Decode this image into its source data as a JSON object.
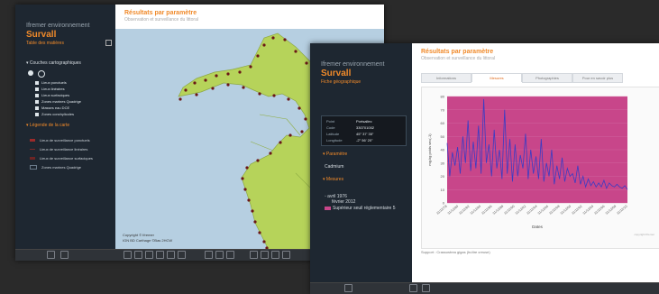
{
  "windows": [
    {
      "app": {
        "logo_text": "Ifremer environnement",
        "brand": "Survall"
      },
      "sidebar": {
        "toc_title": "Table des matières",
        "layers_title": "Couches cartographiques",
        "layers": [
          "Lieux ponctuels",
          "Lieux linéaires",
          "Lieux surfaciques",
          "Zones marines Quadrige",
          "Masses eau DCE",
          "Zones conchylicoles"
        ],
        "legend_title": "Légende de la carte",
        "legend": [
          "Lieux de surveillance ponctuels",
          "Lieux de surveillance linéaires",
          "Lieux de surveillance surfaciques",
          "Zones marines Quadrige"
        ]
      },
      "main": {
        "title": "Résultats par paramètre",
        "subtitle": "Observation et surveillance du littoral",
        "copyright": "Copyright © Ifremer",
        "map_credit": "IGN BD Carthage ©Bas 2HCW"
      }
    },
    {
      "app": {
        "logo_text": "Ifremer environnement",
        "brand": "Survall"
      },
      "sidebar": {
        "fiche_title": "Fiche géographique",
        "info": [
          {
            "label": "Point",
            "value": "Portsallec"
          },
          {
            "label": "Code",
            "value": "330701002"
          },
          {
            "label": "Latitude",
            "value": "45° 37' 35\""
          },
          {
            "label": "Longitude",
            "value": "-2° 56' 20\""
          }
        ],
        "param_title": "Paramètre",
        "param_value": "Cadmium",
        "mesures_title": "Mesures",
        "mesure_from": "avril 1976",
        "mesure_to": "février 2012",
        "mesure_flag": "Supérieur seuil réglementaire",
        "mesure_flag_count": "5"
      },
      "main": {
        "title": "Résultats par paramètre",
        "subtitle": "Observation et surveillance du littoral",
        "tabs": [
          "Informations",
          "Mesures",
          "Photographies",
          "Pour en savoir plus"
        ],
        "active_tab": "Mesures",
        "support": "Support : Crassostrea gigas (huître creuse)",
        "copyright": "copyright Ifremer"
      }
    }
  ],
  "chart_data": {
    "type": "line",
    "title": "",
    "xlabel": "Dates",
    "ylabel": "mg.kg poids sec(-1)",
    "ylim": [
      0,
      80
    ],
    "yticks": [
      0,
      10,
      20,
      30,
      40,
      50,
      60,
      70,
      80
    ],
    "xticks": [
      "31/12/78",
      "31/12/80",
      "31/12/82",
      "31/12/84",
      "31/12/86",
      "31/12/88",
      "31/12/90",
      "31/12/92",
      "31/12/94",
      "31/12/96",
      "31/12/98",
      "31/12/00",
      "31/12/02",
      "31/12/04",
      "31/12/06",
      "31/12/08",
      "31/12/10"
    ],
    "plot_bg": "#c8468a",
    "line_color": "#3a3cc4",
    "series": [
      {
        "values": [
          45,
          20,
          38,
          28,
          42,
          22,
          50,
          30,
          62,
          24,
          46,
          26,
          58,
          22,
          78,
          30,
          44,
          20,
          55,
          26,
          40,
          18,
          70,
          22,
          48,
          16,
          44,
          20,
          36,
          26,
          52,
          18,
          40,
          22,
          35,
          18,
          48,
          16,
          30,
          20,
          40,
          14,
          28,
          18,
          34,
          16,
          26,
          20,
          22,
          15,
          28,
          14,
          20,
          12,
          18,
          13,
          16,
          12,
          15,
          12,
          17,
          11,
          15,
          13,
          12,
          14,
          12,
          11,
          13,
          10
        ]
      }
    ],
    "grid": true
  }
}
